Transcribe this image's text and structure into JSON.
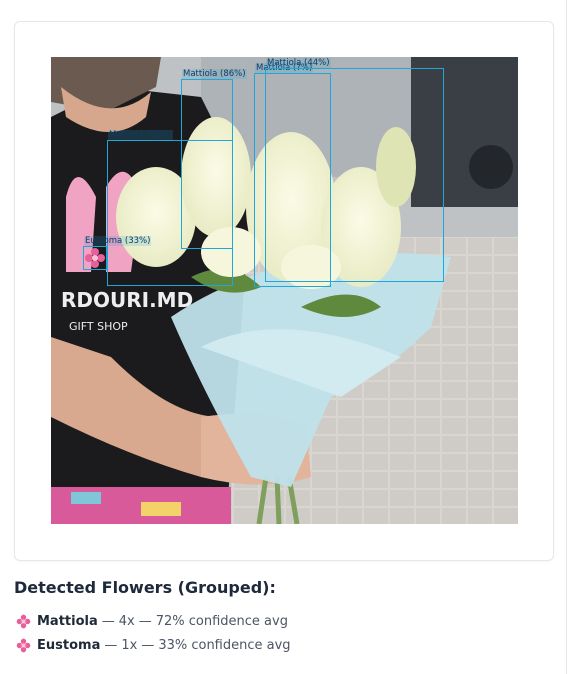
{
  "detection_boxes": [
    {
      "label": "Mattiola (86%)"
    },
    {
      "label": "Mattiola (?%)"
    },
    {
      "label": "Mattiola (44%)"
    },
    {
      "label": "Mattiola (82%)"
    },
    {
      "label": "Eustoma (33%)"
    }
  ],
  "results": {
    "title": "Detected Flowers (Grouped):",
    "items": [
      {
        "name": "Mattiola",
        "count": "4x",
        "confidence": "72% confidence avg"
      },
      {
        "name": "Eustoma",
        "count": "1x",
        "confidence": "33% confidence avg"
      }
    ],
    "separator": "—"
  },
  "colors": {
    "box_stroke": "#1ea7d8",
    "box_label_text": "#123a66",
    "flower_icon": "#e8609a"
  },
  "icons": {
    "result_bullet": "flower-icon"
  }
}
